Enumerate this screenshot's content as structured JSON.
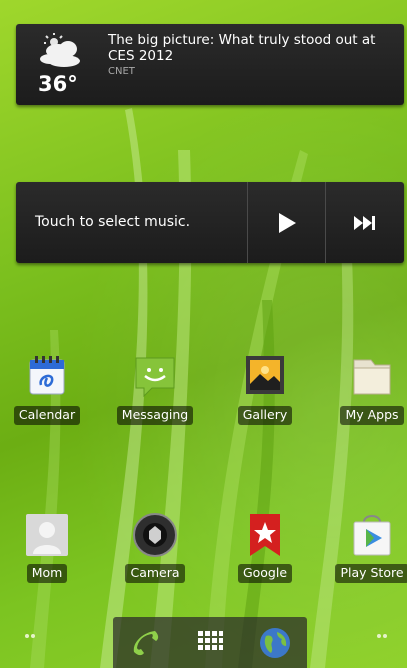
{
  "news_widget": {
    "weather_icon": "partly-cloudy-icon",
    "temperature": "36°",
    "headline": "The big picture: What truly stood out at CES 2012",
    "source": "CNET"
  },
  "music_widget": {
    "prompt": "Touch to select music.",
    "play_icon": "play-icon",
    "next_icon": "skip-next-icon"
  },
  "apps": [
    {
      "label": "Calendar",
      "icon": "calendar-icon"
    },
    {
      "label": "Messaging",
      "icon": "messaging-icon"
    },
    {
      "label": "Gallery",
      "icon": "gallery-icon"
    },
    {
      "label": "My Apps",
      "icon": "folder-icon"
    },
    {
      "label": "Mom",
      "icon": "contact-icon"
    },
    {
      "label": "Camera",
      "icon": "camera-icon"
    },
    {
      "label": "Google",
      "icon": "google-icon"
    },
    {
      "label": "Play Store",
      "icon": "play-store-icon"
    }
  ],
  "dock": {
    "items": [
      "phone-icon",
      "app-drawer-icon",
      "browser-icon"
    ]
  },
  "colors": {
    "wallpaper": "#7bbf1e",
    "widget_bg": "#222222",
    "label_bg": "#000000"
  }
}
